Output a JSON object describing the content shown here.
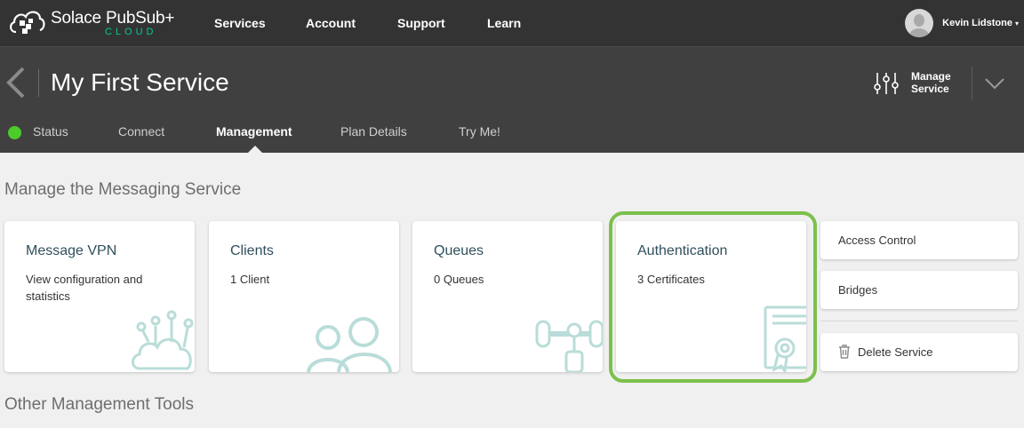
{
  "topnav": {
    "logo_text": "Solace PubSub+",
    "logo_sub": "CLOUD",
    "items": [
      {
        "label": "Services"
      },
      {
        "label": "Account"
      },
      {
        "label": "Support"
      },
      {
        "label": "Learn"
      }
    ],
    "user_name": "Kevin Lidstone",
    "user_caret": "▾"
  },
  "service": {
    "title": "My First Service",
    "manage_label_line1": "Manage",
    "manage_label_line2": "Service",
    "tabs": [
      {
        "label": "Status",
        "active": false
      },
      {
        "label": "Connect",
        "active": false
      },
      {
        "label": "Management",
        "active": true
      },
      {
        "label": "Plan Details",
        "active": false
      },
      {
        "label": "Try Me!",
        "active": false
      }
    ],
    "status_color": "#4ccb2b"
  },
  "content": {
    "section_title": "Manage the Messaging Service",
    "cards": [
      {
        "title": "Message VPN",
        "subtitle": "View configuration and statistics",
        "icon": "cloud-network-icon"
      },
      {
        "title": "Clients",
        "subtitle": "1 Client",
        "icon": "users-icon"
      },
      {
        "title": "Queues",
        "subtitle": "0 Queues",
        "icon": "queue-icon"
      },
      {
        "title": "Authentication",
        "subtitle": "3 Certificates",
        "icon": "certificate-icon",
        "highlighted": true
      }
    ],
    "side_buttons": [
      {
        "label": "Access Control"
      },
      {
        "label": "Bridges"
      },
      {
        "label": "Delete Service",
        "icon": "trash-icon"
      }
    ],
    "other_title": "Other Management Tools"
  },
  "colors": {
    "accent_green": "#7cc04b",
    "brand_teal": "#00c895",
    "art_teal": "#b9ddd9"
  }
}
